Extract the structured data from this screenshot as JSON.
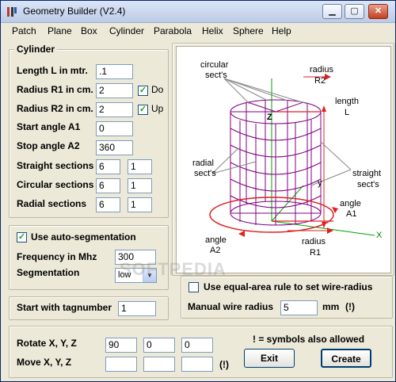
{
  "window": {
    "title": "Geometry Builder (V2.4)"
  },
  "menu": [
    "Patch",
    "Plane",
    "Box",
    "Cylinder",
    "Parabola",
    "Helix",
    "Sphere",
    "Help"
  ],
  "cylinder": {
    "legend": "Cylinder",
    "length_label": "Length L in mtr.",
    "length_value": ".1",
    "r1_label": "Radius R1 in cm.",
    "r1_value": "2",
    "r1_check_label": "Do",
    "r2_label": "Radius R2 in cm.",
    "r2_value": "2",
    "r2_check_label": "Up",
    "start_label": "Start angle A1",
    "start_value": "0",
    "stop_label": "Stop angle A2",
    "stop_value": "360",
    "straight_label": "Straight sections",
    "straight_values": [
      "6",
      "1"
    ],
    "circular_label": "Circular sections",
    "circular_values": [
      "6",
      "1"
    ],
    "radial_label": "Radial sections",
    "radial_values": [
      "6",
      "1"
    ]
  },
  "segmentation": {
    "auto_label": "Use auto-segmentation",
    "freq_label": "Frequency in Mhz",
    "freq_value": "300",
    "seg_label": "Segmentation",
    "seg_value": "low"
  },
  "tag": {
    "label": "Start with tagnumber",
    "value": "1"
  },
  "wire": {
    "equal_area_label": "Use equal-area rule to set wire-radius",
    "manual_label": "Manual wire radius",
    "manual_value": "5",
    "unit": "mm",
    "excl": "(!)"
  },
  "transform": {
    "rotate_label": "Rotate X, Y, Z",
    "rotate_values": [
      "90",
      "0",
      "0"
    ],
    "move_label": "Move X, Y, Z",
    "move_values": [
      "",
      "",
      ""
    ],
    "excl": "(!)",
    "note": "! =  symbols also allowed"
  },
  "buttons": {
    "exit": "Exit",
    "create": "Create"
  },
  "diagram": {
    "circular_sects": [
      "circular",
      "sect's"
    ],
    "radius_r2": [
      "radius",
      "R2"
    ],
    "length": [
      "length",
      "L"
    ],
    "z": "Z",
    "radial_sects": [
      "radial",
      "sect's"
    ],
    "y": "y",
    "straight_sects": [
      "straight",
      "sect's"
    ],
    "angle_a1": [
      "angle",
      "A1"
    ],
    "angle_a2": [
      "angle",
      "A2"
    ],
    "radius_r1": [
      "radius",
      "R1"
    ],
    "x": "X"
  },
  "watermark": "SOFTPEDIA"
}
